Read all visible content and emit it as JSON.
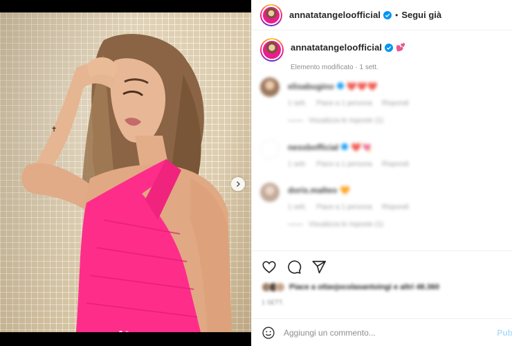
{
  "post": {
    "username": "annatatangeloofficial",
    "separator": "•",
    "follow_label": "Segui già",
    "caption_emoji": "💕",
    "edited_meta": "Elemento modificato · 1 sett.",
    "slides": {
      "current": 1,
      "total": 2
    }
  },
  "comments": [
    {
      "username": "elisabugino",
      "emoji": "❤️❤️❤️",
      "time": "1 sett.",
      "likes": "Piace a 1 persona",
      "reply": "Rispondi",
      "view_replies": "Visualizza le risposte (1)",
      "avatar_color": "#c9a27a"
    },
    {
      "username": "nessbofficial",
      "emoji": "❤️💘",
      "time": "1 sett.",
      "likes": "Piace a 1 persona",
      "reply": "Rispondi",
      "view_replies": "",
      "avatar_color": "#ffffff"
    },
    {
      "username": "doris.malteo",
      "emoji": "🧡",
      "time": "1 sett.",
      "likes": "Piace a 1 persona",
      "reply": "Rispondi",
      "view_replies": "Visualizza le risposte (1)",
      "avatar_color": "#cdb9a8"
    }
  ],
  "likes_text": "Piace a ottavjocolasantoingi e altri 48.360",
  "date_text": "1 SETT.",
  "comment_box": {
    "placeholder": "Aggiungi un commento...",
    "publish_label": "Pub"
  },
  "colors": {
    "accent": "#0095f6",
    "dress": "#ff2d8a",
    "muted": "#8e8e8e"
  },
  "icons": [
    "heart-icon",
    "comment-icon",
    "share-icon",
    "emoji-icon",
    "verified-badge-icon",
    "chevron-right-icon"
  ]
}
